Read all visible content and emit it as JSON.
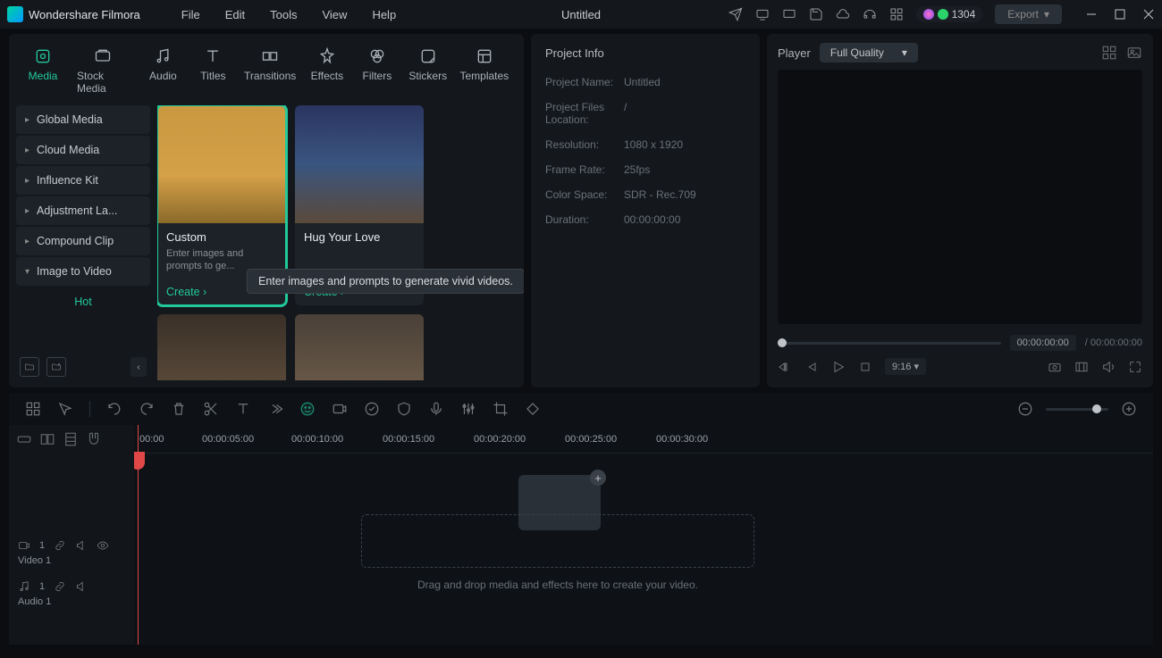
{
  "app": {
    "brand": "Wondershare Filmora",
    "title": "Untitled",
    "coins": "1304",
    "export": "Export"
  },
  "menu": [
    "File",
    "Edit",
    "Tools",
    "View",
    "Help"
  ],
  "tabs": [
    {
      "label": "Media",
      "active": true
    },
    {
      "label": "Stock Media"
    },
    {
      "label": "Audio"
    },
    {
      "label": "Titles"
    },
    {
      "label": "Transitions"
    },
    {
      "label": "Effects"
    },
    {
      "label": "Filters"
    },
    {
      "label": "Stickers"
    },
    {
      "label": "Templates"
    }
  ],
  "sidebar": [
    "Global Media",
    "Cloud Media",
    "Influence Kit",
    "Adjustment La...",
    "Compound Clip",
    "Image to Video"
  ],
  "sidebar_hot": "Hot",
  "cards": [
    {
      "title": "Custom",
      "desc": "Enter images and prompts to ge...",
      "create": "Create",
      "sel": true
    },
    {
      "title": "Hug Your Love",
      "desc": "",
      "create": "Create"
    }
  ],
  "tooltip": "Enter images and prompts to generate vivid videos.",
  "info": {
    "heading": "Project Info",
    "rows": [
      {
        "lbl": "Project Name:",
        "val": "Untitled"
      },
      {
        "lbl": "Project Files Location:",
        "val": "/"
      },
      {
        "lbl": "Resolution:",
        "val": "1080 x 1920"
      },
      {
        "lbl": "Frame Rate:",
        "val": "25fps"
      },
      {
        "lbl": "Color Space:",
        "val": "SDR - Rec.709"
      },
      {
        "lbl": "Duration:",
        "val": "00:00:00:00"
      }
    ]
  },
  "player": {
    "label": "Player",
    "quality": "Full Quality",
    "tc1": "00:00:00:00",
    "tc2": "00:00:00:00",
    "ratio": "9:16"
  },
  "ruler": [
    "00:00",
    "00:00:05:00",
    "00:00:10:00",
    "00:00:15:00",
    "00:00:20:00",
    "00:00:25:00",
    "00:00:30:00"
  ],
  "tracks": {
    "v": "Video 1",
    "v_idx": "1",
    "a": "Audio 1",
    "a_idx": "1"
  },
  "drop": "Drag and drop media and effects here to create your video."
}
